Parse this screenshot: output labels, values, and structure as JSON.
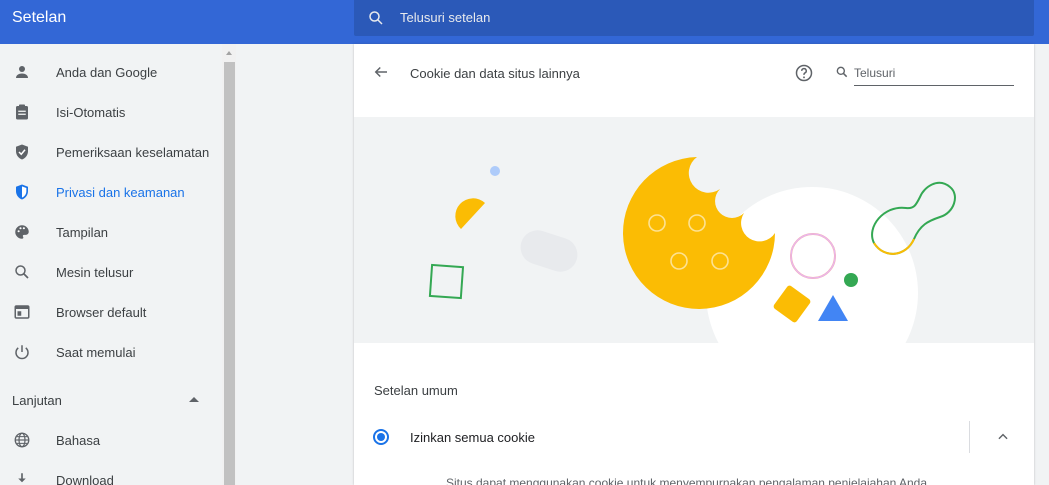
{
  "app": {
    "title": "Setelan"
  },
  "search": {
    "placeholder": "Telusuri setelan"
  },
  "sidebar": {
    "items": [
      {
        "label": "Anda dan Google",
        "icon": "person-icon"
      },
      {
        "label": "Isi-Otomatis",
        "icon": "clipboard-icon"
      },
      {
        "label": "Pemeriksaan keselamatan",
        "icon": "shield-check-icon"
      },
      {
        "label": "Privasi dan keamanan",
        "icon": "shield-icon",
        "active": true
      },
      {
        "label": "Tampilan",
        "icon": "palette-icon"
      },
      {
        "label": "Mesin telusur",
        "icon": "search-icon"
      },
      {
        "label": "Browser default",
        "icon": "browser-icon"
      },
      {
        "label": "Saat memulai",
        "icon": "power-icon"
      }
    ],
    "advanced": {
      "title": "Lanjutan",
      "items": [
        {
          "label": "Bahasa",
          "icon": "globe-icon"
        },
        {
          "label": "Download",
          "icon": "download-icon"
        }
      ]
    }
  },
  "page": {
    "title": "Cookie dan data situs lainnya",
    "search_placeholder": "Telusuri",
    "general_settings_title": "Setelan umum",
    "option": {
      "label": "Izinkan semua cookie",
      "selected": true,
      "description": "Situs dapat menggunakan cookie untuk menyempurnakan pengalaman penjelajahan Anda"
    }
  },
  "colors": {
    "header": "#3367d6",
    "accent": "#1a73e8",
    "cookie": "#fbbc04",
    "green": "#34a853"
  }
}
